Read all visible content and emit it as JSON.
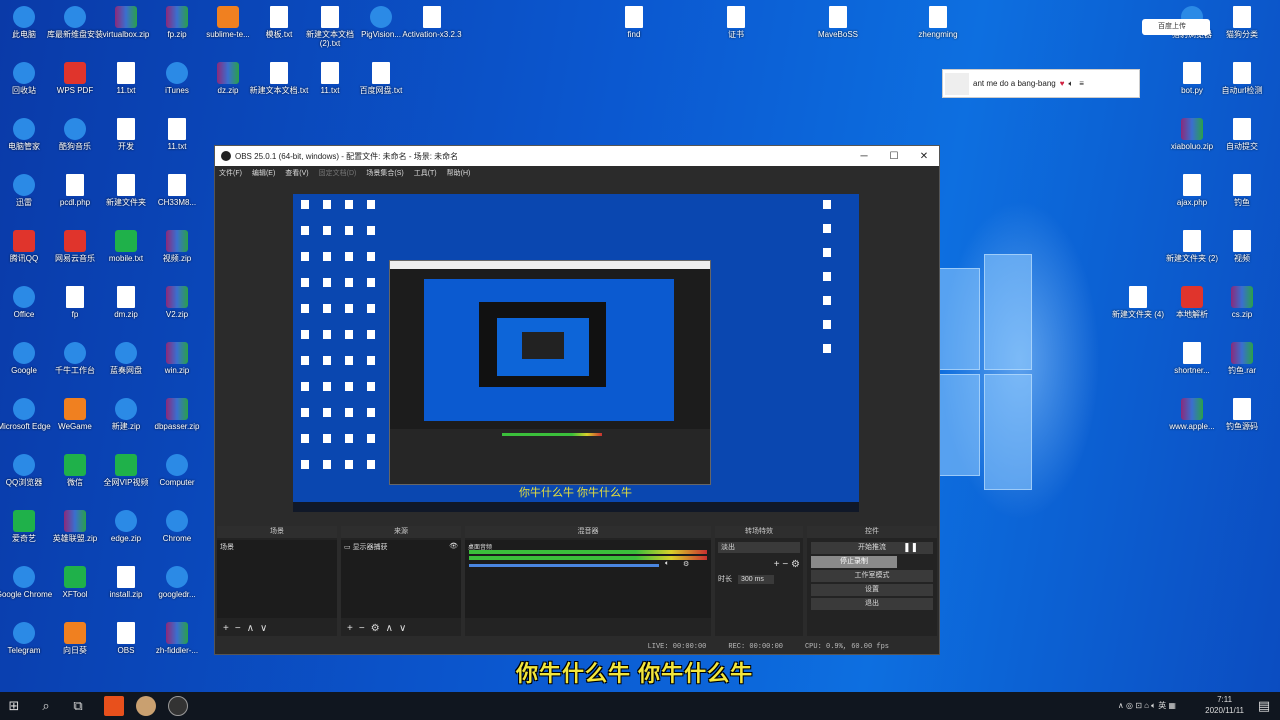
{
  "desktop": {
    "icons": [
      {
        "label": "此电脑",
        "color": "blue"
      },
      {
        "label": "库最新维盘安装",
        "color": "blue"
      },
      {
        "label": "virtualbox.zip",
        "color": "rar"
      },
      {
        "label": "fp.zip",
        "color": "rar"
      },
      {
        "label": "sublime-te...",
        "color": "orange"
      },
      {
        "label": "模板.txt",
        "color": "file"
      },
      {
        "label": "新建文本文档 (2).txt",
        "color": "file"
      },
      {
        "label": "PigVision...",
        "color": "blue"
      },
      {
        "label": "Activation-x3.2.3",
        "color": "file"
      },
      {
        "label": "回收站",
        "color": "blue"
      },
      {
        "label": "WPS PDF",
        "color": "red"
      },
      {
        "label": "11.txt",
        "color": "file"
      },
      {
        "label": "iTunes",
        "color": "blue"
      },
      {
        "label": "dz.zip",
        "color": "rar"
      },
      {
        "label": "新建文本文档.txt",
        "color": "file"
      },
      {
        "label": "11.txt",
        "color": "file"
      },
      {
        "label": "百度网盘.txt",
        "color": "file"
      },
      {
        "label": "电脑管家",
        "color": "blue"
      },
      {
        "label": "酷狗音乐",
        "color": "blue"
      },
      {
        "label": "开发",
        "color": "file"
      },
      {
        "label": "11.txt",
        "color": "file"
      },
      {
        "label": "迅雷",
        "color": "blue"
      },
      {
        "label": "pcdl.php",
        "color": "file"
      },
      {
        "label": "新建文件夹",
        "color": "file"
      },
      {
        "label": "CH33M8...",
        "color": "file"
      },
      {
        "label": "腾讯QQ",
        "color": "red"
      },
      {
        "label": "网易云音乐",
        "color": "red"
      },
      {
        "label": "mobile.txt",
        "color": "green"
      },
      {
        "label": "视频.zip",
        "color": "rar"
      },
      {
        "label": "Office",
        "color": "blue"
      },
      {
        "label": "fp",
        "color": "file"
      },
      {
        "label": "dm.zip",
        "color": "file"
      },
      {
        "label": "V2.zip",
        "color": "rar"
      },
      {
        "label": "Google",
        "color": "blue"
      },
      {
        "label": "千牛工作台",
        "color": "blue"
      },
      {
        "label": "蓝奏网盘",
        "color": "blue"
      },
      {
        "label": "win.zip",
        "color": "rar"
      },
      {
        "label": "Microsoft Edge",
        "color": "blue"
      },
      {
        "label": "WeGame",
        "color": "orange"
      },
      {
        "label": "新建.zip",
        "color": "blue"
      },
      {
        "label": "dbpasser.zip",
        "color": "rar"
      },
      {
        "label": "QQ浏览器",
        "color": "blue"
      },
      {
        "label": "微信",
        "color": "green"
      },
      {
        "label": "全网VIP视频",
        "color": "green"
      },
      {
        "label": "Computer",
        "color": "blue"
      },
      {
        "label": "爱奇艺",
        "color": "green"
      },
      {
        "label": "英雄联盟.zip",
        "color": "rar"
      },
      {
        "label": "edge.zip",
        "color": "blue"
      },
      {
        "label": "Chrome",
        "color": "blue"
      },
      {
        "label": "Google Chrome",
        "color": "blue"
      },
      {
        "label": "XFTool",
        "color": "green"
      },
      {
        "label": "install.zip",
        "color": "file"
      },
      {
        "label": "googledr...",
        "color": "blue"
      },
      {
        "label": "Telegram",
        "color": "blue"
      },
      {
        "label": "向日葵",
        "color": "orange"
      },
      {
        "label": "OBS",
        "color": "file"
      },
      {
        "label": "zh-fiddler-...",
        "color": "rar"
      }
    ],
    "right_icons": [
      {
        "label": "find",
        "color": "file"
      },
      {
        "label": "证书",
        "color": "file"
      },
      {
        "label": "MaveBoSS",
        "color": "file"
      },
      {
        "label": "zhengming",
        "color": "file"
      },
      {
        "label": "bot.py",
        "color": "file"
      },
      {
        "label": "自动url检测",
        "color": "file"
      },
      {
        "label": "xiaboluo.zip",
        "color": "rar"
      },
      {
        "label": "自动提交",
        "color": "file"
      },
      {
        "label": "ajax.php",
        "color": "file"
      },
      {
        "label": "钓鱼",
        "color": "file"
      },
      {
        "label": "新建文件夹 (2)",
        "color": "file"
      },
      {
        "label": "视频",
        "color": "file"
      },
      {
        "label": "新建文件夹 (4)",
        "color": "file"
      },
      {
        "label": "本地解析",
        "color": "red"
      },
      {
        "label": "cs.zip",
        "color": "rar"
      },
      {
        "label": "shortner...",
        "color": "file"
      },
      {
        "label": "钓鱼.rar",
        "color": "rar"
      },
      {
        "label": "www.apple...",
        "color": "rar"
      },
      {
        "label": "钓鱼源码",
        "color": "file"
      },
      {
        "label": "猎豹浏览器",
        "color": "blue"
      },
      {
        "label": "猫狗分类",
        "color": "file"
      }
    ]
  },
  "notification": {
    "text": "ant me do a bang-bang"
  },
  "baidu_widget": {
    "label": "百度上传"
  },
  "obs": {
    "title": "OBS 25.0.1 (64-bit, windows) - 配置文件: 未命名 - 场景: 未命名",
    "menu": [
      "文件(F)",
      "编辑(E)",
      "查看(V)",
      "固定文档(D)",
      "场景集合(S)",
      "工具(T)",
      "帮助(H)"
    ],
    "preview_caption": "你牛什么牛 你牛什么牛",
    "docks": {
      "scenes": {
        "title": "场景",
        "item": "场景"
      },
      "sources": {
        "title": "来源",
        "item": "显示器捕获"
      },
      "mixer": {
        "title": "混音器",
        "item": "桌面音频"
      },
      "transitions": {
        "title": "转场特效",
        "mode": "淡出",
        "duration_label": "时长",
        "duration": "300 ms"
      },
      "controls": {
        "title": "控件",
        "buttons": [
          "开始推流",
          "停止录制",
          "工作室模式",
          "设置",
          "退出"
        ]
      }
    },
    "status": {
      "live": "LIVE: 00:00:00",
      "rec": "REC: 00:00:00",
      "cpu": "CPU: 0.9%, 60.00 fps"
    }
  },
  "subtitle": "你牛什么牛 你牛什么牛",
  "taskbar": {
    "time": "7:11",
    "date": "2020/11/11"
  }
}
